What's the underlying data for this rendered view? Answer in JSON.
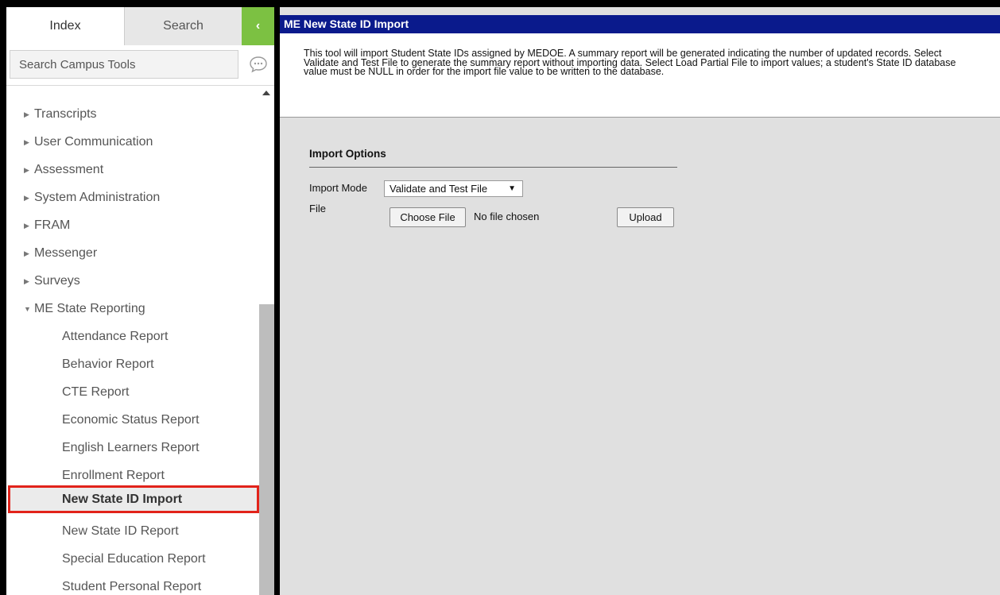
{
  "sidebar": {
    "tabs": {
      "index": "Index",
      "search": "Search"
    },
    "collapse_glyph": "‹",
    "search_placeholder": "Search Campus Tools",
    "categories": [
      "Transcripts",
      "User Communication",
      "Assessment",
      "System Administration",
      "FRAM",
      "Messenger",
      "Surveys"
    ],
    "expanded_category": "ME State Reporting",
    "sub_items": [
      "Attendance Report",
      "Behavior Report",
      "CTE Report",
      "Economic Status Report",
      "English Learners Report",
      "Enrollment Report",
      "New State ID Import",
      "New State ID Report",
      "Special Education Report",
      "Student Personal Report"
    ],
    "selected_item": "New State ID Import"
  },
  "main": {
    "title": "ME New State ID Import",
    "description": "This tool will import Student State IDs assigned by MEDOE. A summary report will be generated indicating the number of updated records. Select Validate and Test File to generate the summary report without importing data. Select Load Partial File to import values; a student's State ID database value must be NULL in order for the import file value to be written to the database.",
    "import_options": {
      "heading": "Import Options",
      "mode_label": "Import Mode",
      "mode_value": "Validate and Test File",
      "file_label": "File",
      "choose_file_label": "Choose File",
      "no_file_text": "No file chosen",
      "upload_label": "Upload"
    }
  },
  "colors": {
    "title_bar": "#0a1a8c",
    "collapse_button": "#7cc142",
    "selected_border": "#e2231a",
    "content_background": "#e0e0e0"
  }
}
